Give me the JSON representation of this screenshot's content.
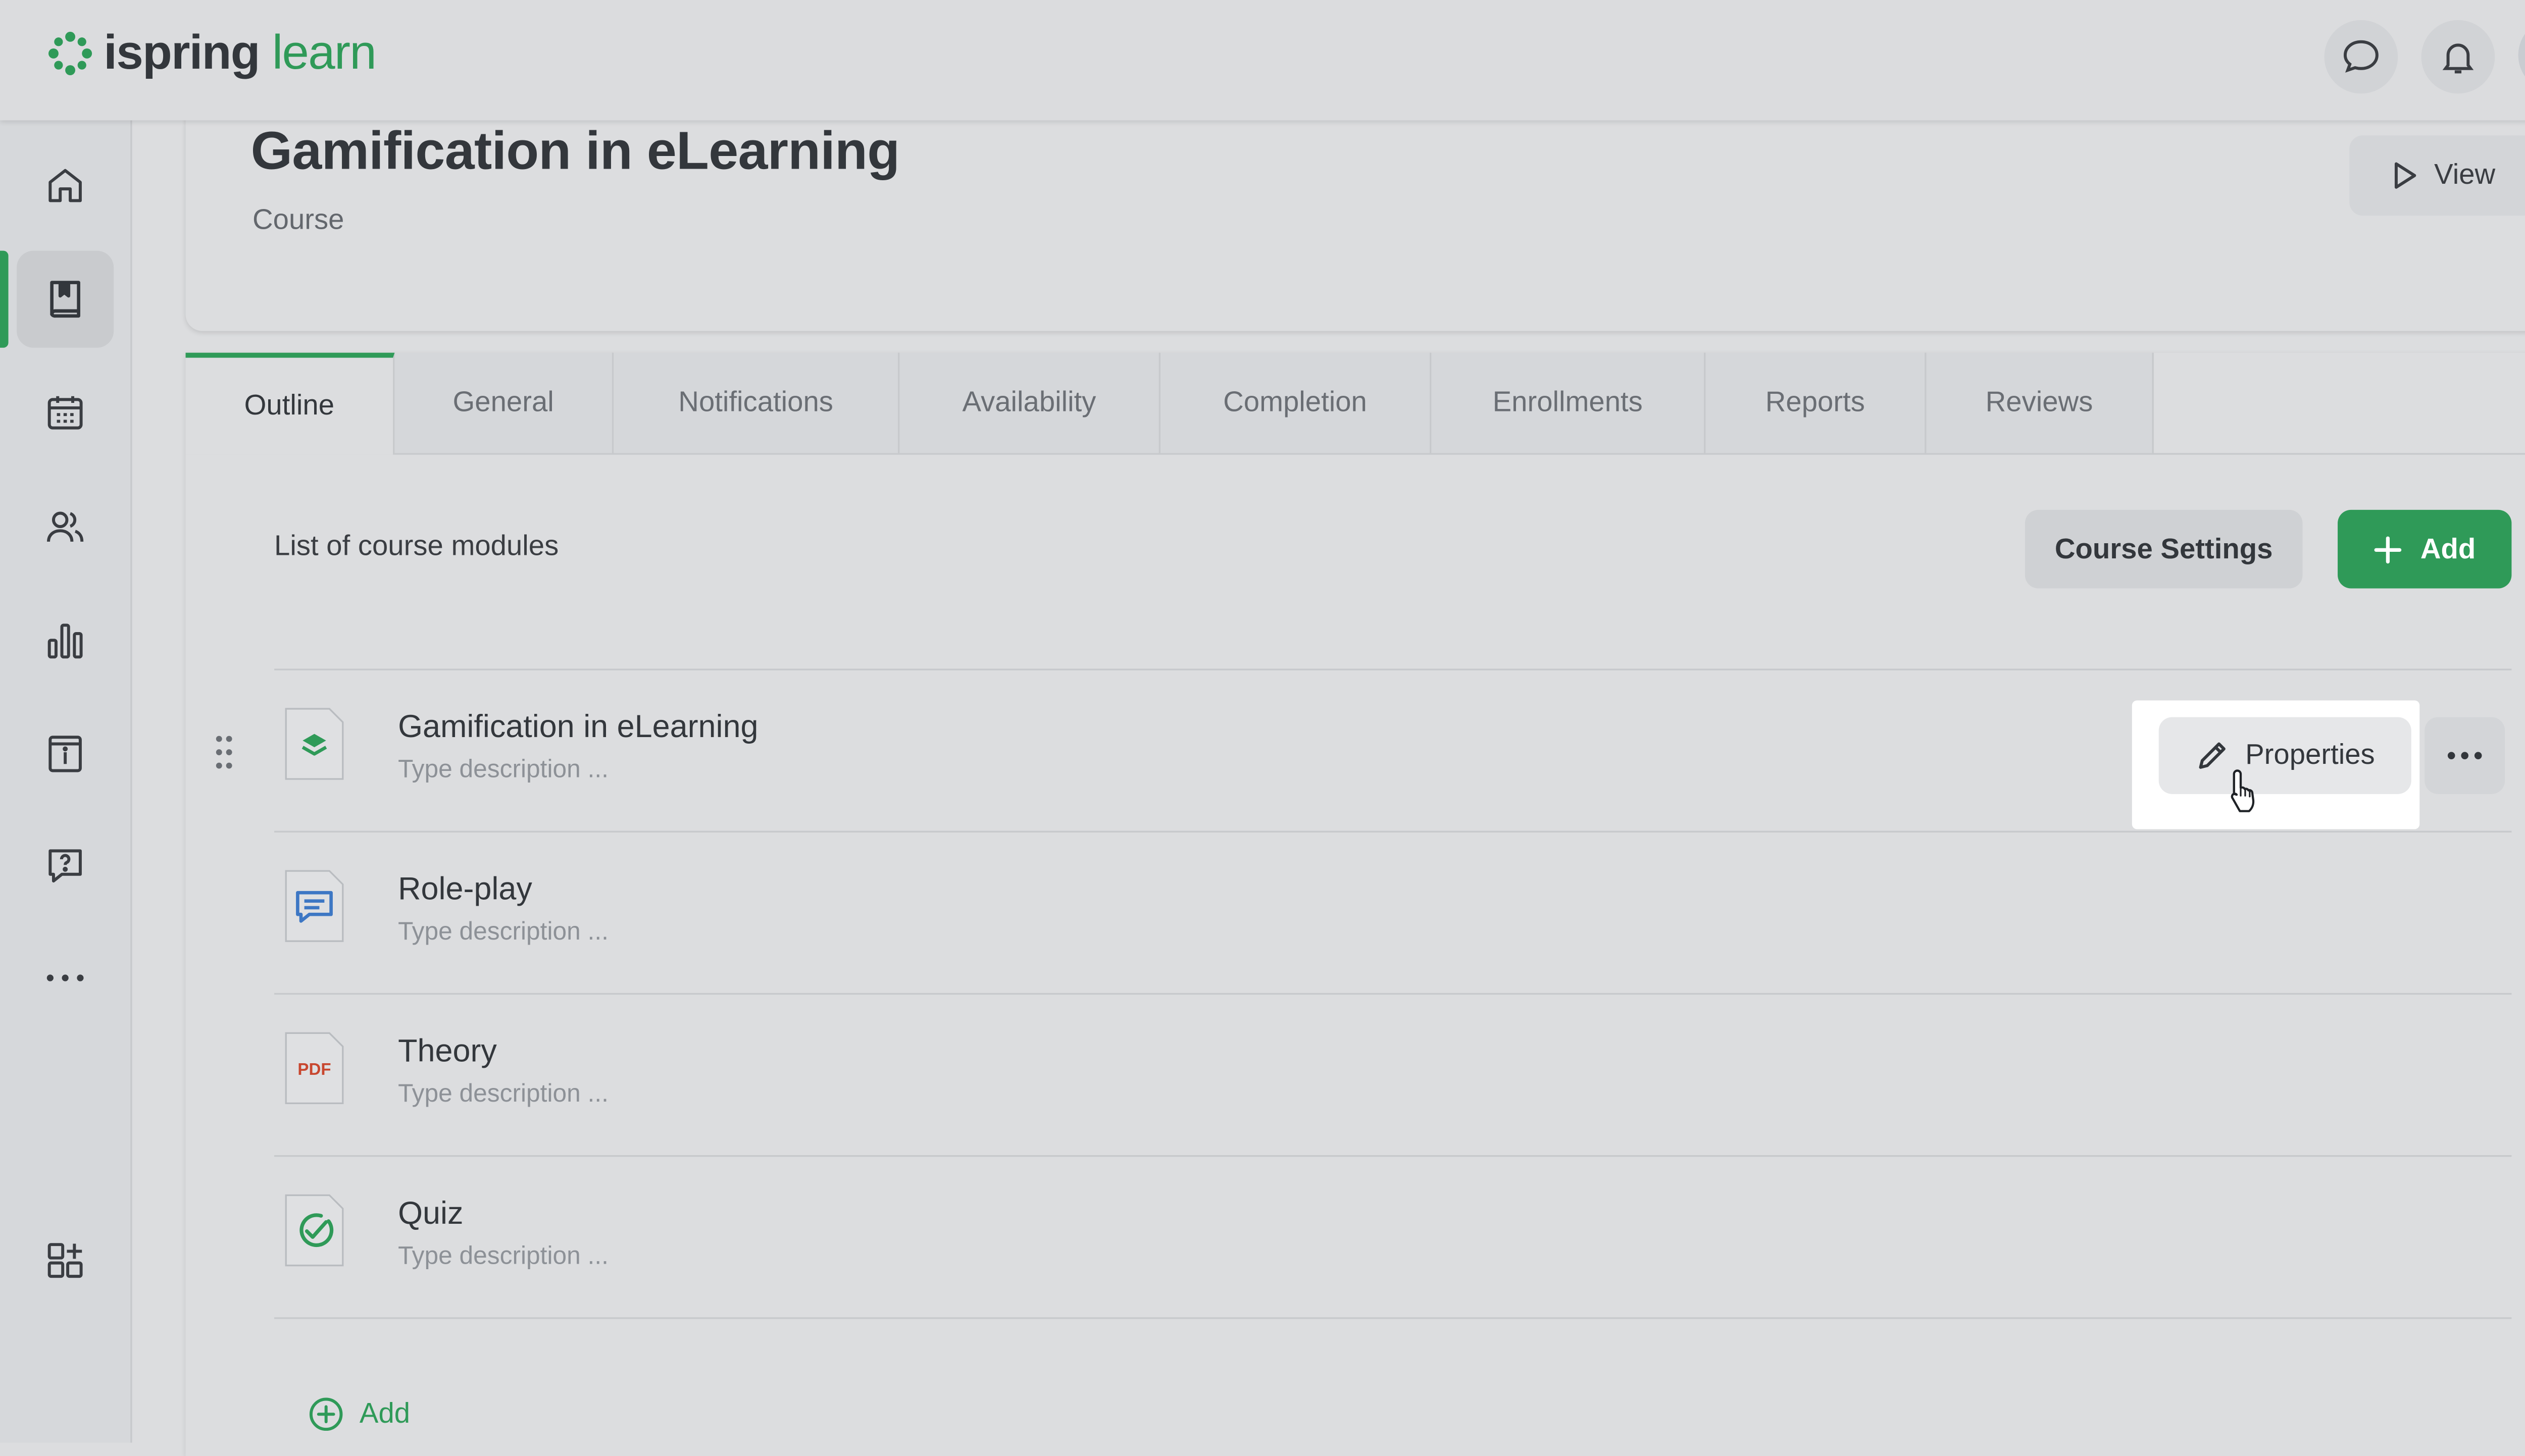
{
  "app": {
    "logo_primary": "ispring",
    "logo_secondary": "learn",
    "brand_color": "#2f9a58"
  },
  "topbar": {
    "icons": [
      "chat-icon",
      "bell-icon",
      "user-avatar"
    ]
  },
  "sidebar": {
    "items": [
      {
        "icon": "home-icon"
      },
      {
        "icon": "book-icon",
        "active": true
      },
      {
        "icon": "calendar-icon"
      },
      {
        "icon": "users-icon"
      },
      {
        "icon": "chart-icon"
      },
      {
        "icon": "info-book-icon"
      },
      {
        "icon": "question-chat-icon"
      },
      {
        "icon": "more-icon"
      },
      {
        "icon": "apps-icon"
      }
    ]
  },
  "header": {
    "title": "Gamification in eLearning",
    "subtitle": "Course",
    "view_label": "View"
  },
  "tabs": [
    {
      "label": "Outline",
      "active": true
    },
    {
      "label": "General"
    },
    {
      "label": "Notifications"
    },
    {
      "label": "Availability"
    },
    {
      "label": "Completion"
    },
    {
      "label": "Enrollments"
    },
    {
      "label": "Reports"
    },
    {
      "label": "Reviews"
    }
  ],
  "outline": {
    "list_label": "List of course modules",
    "course_settings_label": "Course Settings",
    "add_label": "Add",
    "properties_label": "Properties",
    "add_link_label": "Add",
    "modules": [
      {
        "title": "Gamification in eLearning",
        "description": "Type description ...",
        "type_icon": "layers-icon"
      },
      {
        "title": "Role-play",
        "description": "Type description ...",
        "type_icon": "chat-doc-icon"
      },
      {
        "title": "Theory",
        "description": "Type description ...",
        "type_icon": "pdf-icon",
        "type_text": "PDF"
      },
      {
        "title": "Quiz",
        "description": "Type description ...",
        "type_icon": "check-circle-icon"
      }
    ]
  }
}
